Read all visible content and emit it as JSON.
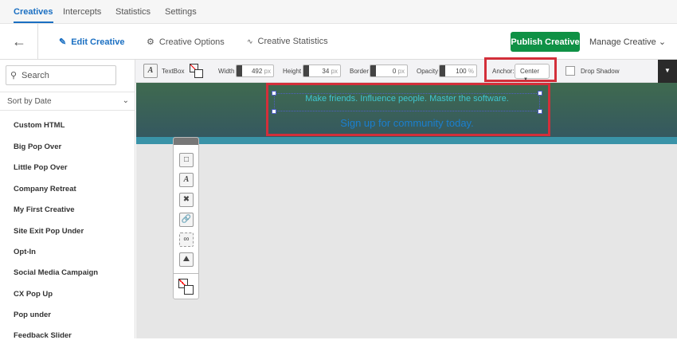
{
  "tabs": [
    "Creatives",
    "Intercepts",
    "Statistics",
    "Settings"
  ],
  "nav": {
    "edit": "Edit Creative",
    "options": "Creative Options",
    "stats": "Creative Statistics",
    "publish": "Publish Creative",
    "manage": "Manage Creative"
  },
  "sidebar": {
    "search_placeholder": "Search",
    "sort": "Sort by Date",
    "items": [
      "Custom HTML",
      "Big Pop Over",
      "Little Pop Over",
      "Company Retreat",
      "My First Creative",
      "Site Exit Pop Under",
      "Opt-In",
      "Social Media Campaign",
      "CX Pop Up",
      "Pop under",
      "Feedback Slider"
    ]
  },
  "toolbar": {
    "textbox": "TextBox",
    "width_label": "Width",
    "width": "492",
    "height_label": "Height",
    "height": "34",
    "border_label": "Border",
    "border": "0",
    "opacity_label": "Opacity",
    "opacity": "100",
    "px": "px",
    "pct": "%",
    "anchor_label": "Anchor:",
    "anchor": "Center",
    "drop_shadow": "Drop Shadow"
  },
  "canvas": {
    "line1": "Make friends. Influence people. Master the software.",
    "line2": "Sign up for community today."
  },
  "colors": {
    "accent": "#1a6fc2",
    "publish": "#0f9145",
    "highlight": "#d32f3a"
  }
}
